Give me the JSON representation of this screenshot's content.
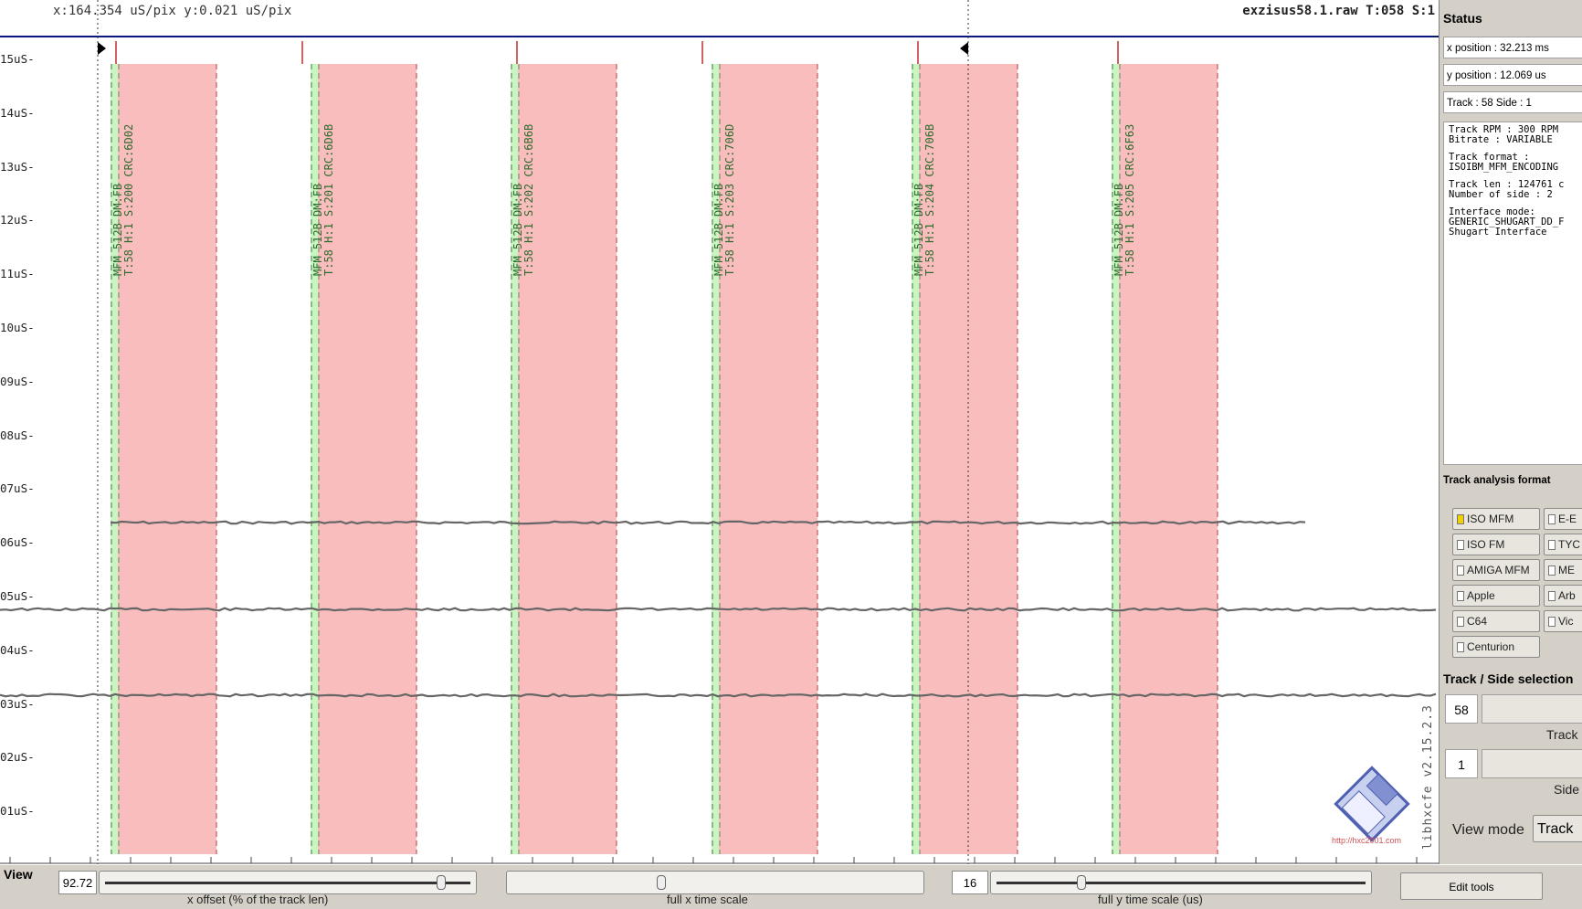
{
  "scope": {
    "header_left": "x:164.354 uS/pix  y:0.021 uS/pix",
    "header_right": "exzisus58.1.raw T:058 S:1",
    "y_labels": [
      "15uS-",
      "14uS-",
      "13uS-",
      "12uS-",
      "11uS-",
      "10uS-",
      "09uS-",
      "08uS-",
      "07uS-",
      "06uS-",
      "05uS-",
      "04uS-",
      "03uS-",
      "02uS-",
      "01uS-"
    ],
    "sectors": [
      {
        "line1": "MFM 512B DM:FB",
        "line2": "T:58 H:1 S:200 CRC:6D02"
      },
      {
        "line1": "MFM 512B DM:FB",
        "line2": "T:58 H:1 S:201 CRC:6D6B"
      },
      {
        "line1": "MFM 512B DM:FB",
        "line2": "T:58 H:1 S:202 CRC:6B6B"
      },
      {
        "line1": "MFM 512B DM:FB",
        "line2": "T:58 H:1 S:203 CRC:706D"
      },
      {
        "line1": "MFM 512B DM:FB",
        "line2": "T:58 H:1 S:204 CRC:706B"
      },
      {
        "line1": "MFM 512B DM:FB",
        "line2": "T:58 H:1 S:205 CRC:6F63"
      }
    ],
    "version_text": "libhxcfe v2.15.2.3",
    "watermark_url": "http://hxc2001.com",
    "colors": {
      "sector_data": "#f9bdbd",
      "sync_mark": "#c8f5c0",
      "trace": "#666666",
      "marker": "#c03030",
      "header_line": "#0a1a7a"
    }
  },
  "status": {
    "title": "Status",
    "x_position": "x position : 32.213 ms",
    "y_position": "y position : 12.069 us",
    "track_side": "Track : 58 Side : 1",
    "info": [
      "Track RPM : 300 RPM",
      "Bitrate : VARIABLE",
      "",
      "Track format :",
      "ISOIBM_MFM_ENCODING",
      "",
      "Track len : 124761 c",
      "Number of side : 2",
      "",
      "Interface mode:",
      "GENERIC_SHUGART_DD_F",
      "Shugart Interface"
    ]
  },
  "analysis": {
    "title": "Track analysis format",
    "left_options": [
      {
        "label": "ISO MFM",
        "checked": true
      },
      {
        "label": "ISO FM",
        "checked": false
      },
      {
        "label": "AMIGA MFM",
        "checked": false
      },
      {
        "label": "Apple",
        "checked": false
      },
      {
        "label": "C64",
        "checked": false
      },
      {
        "label": "Centurion",
        "checked": false
      }
    ],
    "right_options": [
      "E-E",
      "TYC",
      "ME",
      "Arb",
      "Vic"
    ]
  },
  "selection": {
    "title": "Track / Side selection",
    "track_value": "58",
    "track_label": "Track",
    "side_value": "1",
    "side_label": "Side",
    "view_mode_label": "View mode",
    "view_mode_value": "Track"
  },
  "bottom": {
    "view_label": "View",
    "x_offset_value": "92.72",
    "x_offset_caption": "x offset (% of the track len)",
    "x_offset_percent": 92.72,
    "x_scale_caption": "full x time scale",
    "y_scale_value": "16",
    "y_scale_caption": "full y time scale (us)",
    "edit_tools_label": "Edit tools"
  }
}
